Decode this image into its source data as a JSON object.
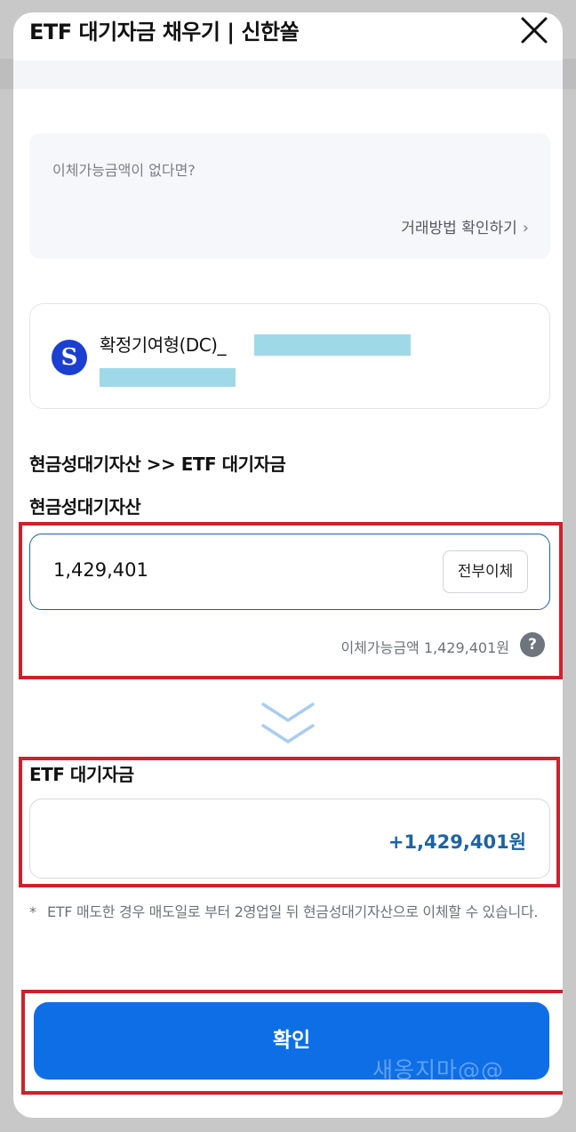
{
  "header": {
    "title": "ETF 대기자금 채우기 | 신한쏠",
    "close_icon": "close-icon"
  },
  "info": {
    "question": "이체가능금액이 없다면?",
    "link_label": "거래방법 확인하기",
    "link_icon": "chevron-right-icon"
  },
  "account": {
    "logo_icon": "shinhan-logo-icon",
    "name": "확정기여형(DC)_"
  },
  "transfer": {
    "flow_label": "현금성대기자산 >> ETF 대기자금",
    "source_label": "현금성대기자산",
    "source_value": "1,429,401",
    "transfer_all_label": "전부이체",
    "available_text": "이체가능금액 1,429,401원",
    "help_icon": "?",
    "destination_label": "ETF 대기자금",
    "destination_value": "+1,429,401원"
  },
  "notice": {
    "star": "*",
    "text": "ETF 매도한 경우 매도일로 부터 2영업일 뒤 현금성대기자산으로 이체할 수 있습니다."
  },
  "confirm_label": "확인",
  "watermark": "새옹지마@@",
  "colors": {
    "primary": "#0e6ee6",
    "highlight_red": "#d0202a",
    "destination_text": "#1b63a8",
    "mask": "#9fd9e8"
  }
}
